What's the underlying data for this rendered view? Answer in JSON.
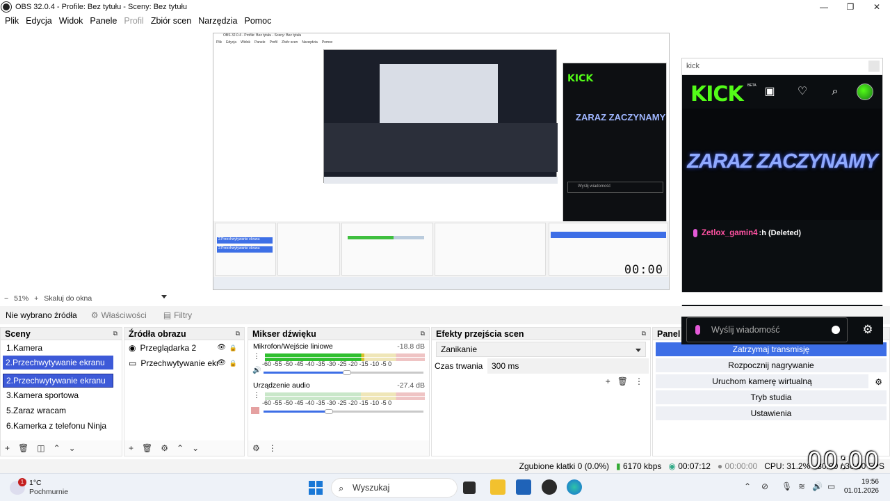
{
  "window": {
    "title": "OBS 32.0.4 - Profile: Bez tytułu - Sceny: Bez tytułu"
  },
  "menu": [
    "Plik",
    "Edycja",
    "Widok",
    "Panele",
    "Profil",
    "Zbiór scen",
    "Narzędzia",
    "Pomoc"
  ],
  "preview": {
    "nested_clock": "00:00",
    "nested_sel_a": "2.Przechwytywanie ekranu",
    "nested_sel_b": "2.Przechwytywanie ekranu",
    "nested_kick_logo": "KICK",
    "nested_kick_zaraz": "ZARAZ ZACZYNAMY",
    "nested_kick_msg": "Wyślij wiadomość"
  },
  "kick": {
    "url": "kick",
    "logo": "KICK",
    "beta": "BETA",
    "headline": "ZARAZ ZACZYNAMY",
    "chat_user": "Zetlox_gamin4",
    "chat_sep": ":",
    "chat_msg": " h (Deleted)",
    "input_placeholder": "Wyślij wiadomość"
  },
  "zoom": {
    "minus": "−",
    "value": "51%",
    "plus": "+",
    "mode": "Skaluj do okna"
  },
  "context": {
    "no_source": "Nie wybrano źródła",
    "properties": "Właściwości",
    "filters": "Filtry"
  },
  "scenes": {
    "title": "Sceny",
    "items": [
      "1.Kamera",
      "2.Przechwytywanie ekranu",
      "2.Przechwytywanie ekranu",
      "3.Kamera sportowa",
      "5.Zaraz wracam",
      "6.Kamerka z telefonu Ninja"
    ]
  },
  "sources": {
    "title": "Źródła obrazu",
    "items": [
      "Przeglądarka 2",
      "Przechwytywanie ekr"
    ]
  },
  "mixer": {
    "title": "Mikser dźwięku",
    "channels": [
      {
        "name": "Mikrofon/Wejście liniowe",
        "db": "-18.8 dB",
        "level": 0.62,
        "volume": 0.52
      },
      {
        "name": "Urządzenie audio",
        "db": "-27.4 dB",
        "level": 0.0,
        "volume": 0.41
      }
    ],
    "ticks": "-60  -55  -50  -45  -40  -35  -30  -25  -20  -15  -10   -5    0"
  },
  "transitions": {
    "title": "Efekty przejścia scen",
    "selected": "Zanikanie",
    "duration_label": "Czas trwania",
    "duration_value": "300 ms"
  },
  "controls": {
    "title": "Panel s",
    "buttons": [
      "Zatrzymaj transmisję",
      "Rozpocznij nagrywanie",
      "Uruchom kamerę wirtualną",
      "Tryb studia",
      "Ustawienia"
    ]
  },
  "status": {
    "dropped": "Zgubione klatki 0 (0.0%)",
    "bitrate": "6170 kbps",
    "stream_time": "00:07:12",
    "rec_time": "00:00:00",
    "cpu": "CPU: 31.2%",
    "fps": "30.00 / 30.00 FPS",
    "overlay_clock": "00:00"
  },
  "taskbar": {
    "weather_badge": "1",
    "temp": "1°C",
    "weather": "Pochmurnie",
    "search": "Wyszukaj",
    "time": "19:56",
    "date": "01.01.2026"
  },
  "colors": {
    "accent": "#3d5ad8",
    "kick_green": "#53fc18",
    "chat_user": "#ff52a2"
  }
}
